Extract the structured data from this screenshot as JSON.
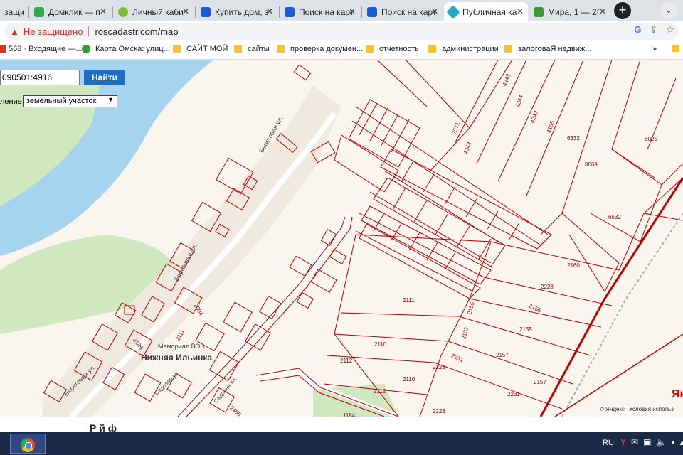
{
  "tabs": [
    {
      "label": "защи",
      "fav": "#f0a020"
    },
    {
      "label": "Домклик — п",
      "fav": "#2fa84f"
    },
    {
      "label": "Личный каби",
      "fav": "#7cbf3a"
    },
    {
      "label": "Купить дом, з",
      "fav": "#1d5bd6"
    },
    {
      "label": "Поиск на карт",
      "fav": "#1d5bd6"
    },
    {
      "label": "Поиск на карт",
      "fav": "#1d5bd6"
    },
    {
      "label": "Публичная ка",
      "fav": "#2aa7c9",
      "active": true
    },
    {
      "label": "Мира, 1 — 2Г",
      "fav": "#3a9a3a"
    }
  ],
  "newtab_label": "+",
  "tabmenu_label": "⌄",
  "address": {
    "insecure_label": "Не защищено",
    "url": "roscadastr.com/map"
  },
  "omni_icons": [
    "G",
    "⇪",
    "☆"
  ],
  "bookmarks": [
    {
      "label": "568 · Входящие —..."
    },
    {
      "label": "Карта Омска: улиц..."
    },
    {
      "label": "САЙТ МОЙ"
    },
    {
      "label": "сайты"
    },
    {
      "label": "проверка докумен..."
    },
    {
      "label": "отчетность"
    },
    {
      "label": "администрации"
    },
    {
      "label": "залоговаЯ недвиж..."
    }
  ],
  "bookmarks_more": "»",
  "search": {
    "value": "090501:4916",
    "button": "Найти"
  },
  "layer_select": {
    "label": "ление:",
    "value": "земельный участок"
  },
  "map": {
    "streets": [
      "Береговая ул.",
      "Береговая ул.",
      "Береговая ул.",
      "Садовая ул.",
      "Садовая ул."
    ],
    "place": "Нижняя Ильинка",
    "memorial": "Мемориал ВОВ",
    "parcel_labels": [
      "4243",
      "4244",
      "4242",
      "4185",
      "7571",
      "4243",
      "6332",
      "8069",
      "8025",
      "6532",
      "2160",
      "2228",
      "2156",
      "2155",
      "2157",
      "2157",
      "2157",
      "2155",
      "2111",
      "2110",
      "2112",
      "2110",
      "2112",
      "2231",
      "2223",
      "2223",
      "2231",
      "2004",
      "2185",
      "2111",
      "2455",
      "1184"
    ],
    "yandex_mark": "Ян"
  },
  "copyright": {
    "text": "© Яндекс",
    "terms": "Условия использ"
  },
  "footer_text": "Р                й ф",
  "taskbar": {
    "lang": "RU",
    "tray_icons": [
      "Y",
      "✉",
      "▣",
      "🔈",
      "▪",
      "▴"
    ]
  }
}
